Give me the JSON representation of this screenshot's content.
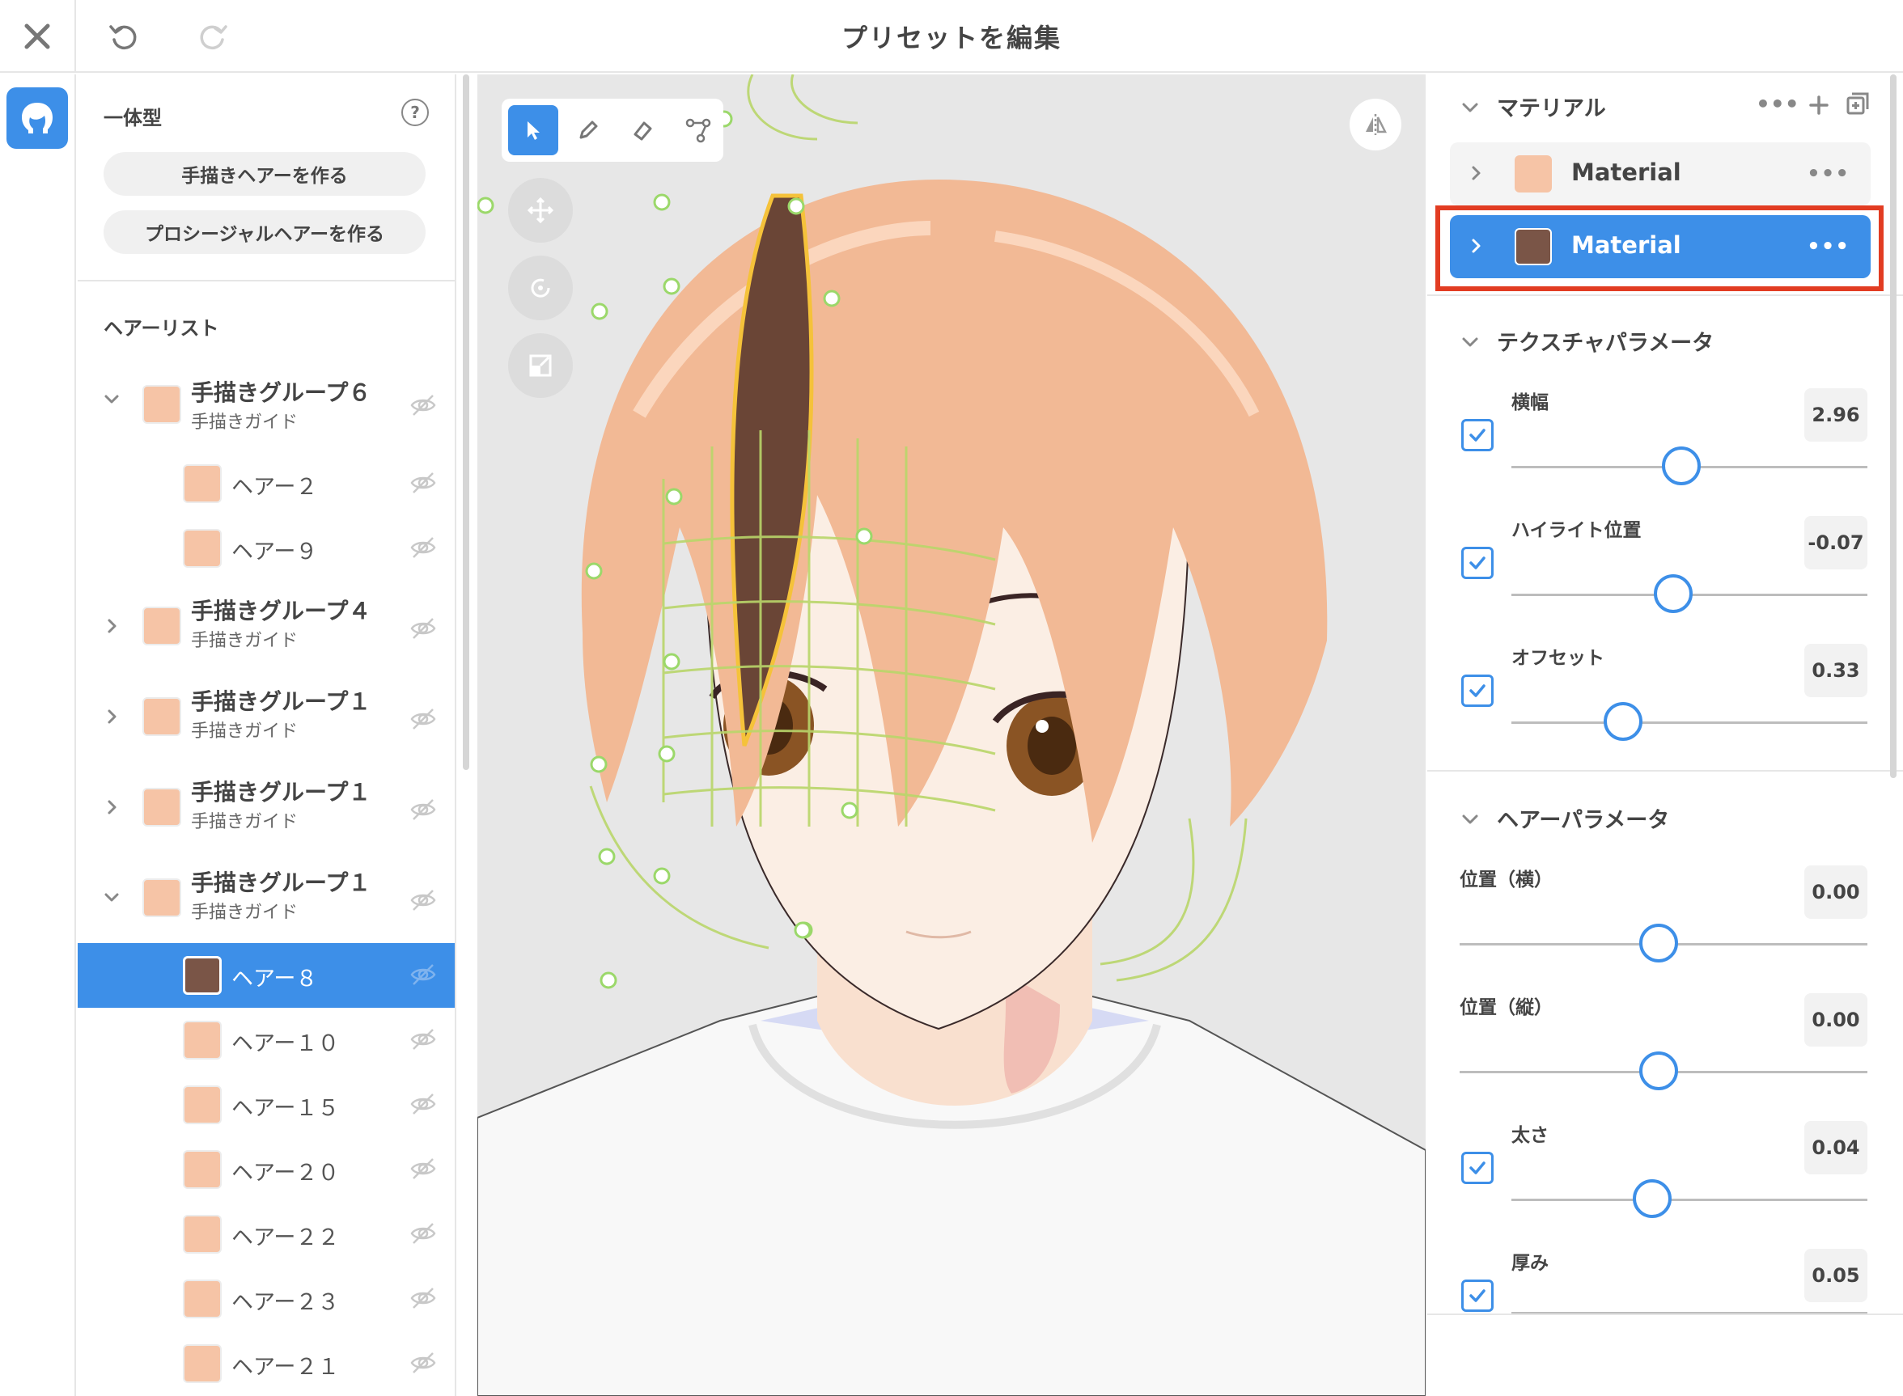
{
  "window": {
    "title": "プリセットを編集"
  },
  "colors": {
    "accent": "#3d8fe8",
    "hair_light": "#f6c4a6",
    "hair_dark": "#7a5547",
    "highlight_border": "#e23c22"
  },
  "left_panel": {
    "mode_label": "一体型",
    "buttons": {
      "hand_drawn": "手描きヘアーを作る",
      "procedural": "プロシージャルヘアーを作る"
    },
    "list_title": "ヘアーリスト",
    "items": [
      {
        "type": "group",
        "name": "手描きグループ６",
        "sub": "手描きガイド",
        "expanded": true
      },
      {
        "type": "hair",
        "name": "ヘアー２",
        "color": "light"
      },
      {
        "type": "hair",
        "name": "ヘアー９",
        "color": "light"
      },
      {
        "type": "group",
        "name": "手描きグループ４",
        "sub": "手描きガイド",
        "expanded": false
      },
      {
        "type": "group",
        "name": "手描きグループ１",
        "sub": "手描きガイド",
        "expanded": false
      },
      {
        "type": "group",
        "name": "手描きグループ１",
        "sub": "手描きガイド",
        "expanded": false
      },
      {
        "type": "group",
        "name": "手描きグループ１",
        "sub": "手描きガイド",
        "expanded": true
      },
      {
        "type": "hair",
        "name": "ヘアー８",
        "color": "dark",
        "selected": true
      },
      {
        "type": "hair",
        "name": "ヘアー１０",
        "color": "light"
      },
      {
        "type": "hair",
        "name": "ヘアー１５",
        "color": "light"
      },
      {
        "type": "hair",
        "name": "ヘアー２０",
        "color": "light"
      },
      {
        "type": "hair",
        "name": "ヘアー２２",
        "color": "light"
      },
      {
        "type": "hair",
        "name": "ヘアー２３",
        "color": "light"
      },
      {
        "type": "hair",
        "name": "ヘアー２１",
        "color": "light"
      }
    ]
  },
  "right_panel": {
    "material_section": {
      "title": "マテリアル",
      "materials": [
        {
          "label": "Material",
          "color": "#f6c4a6",
          "active": false
        },
        {
          "label": "Material",
          "color": "#7a5547",
          "active": true
        }
      ]
    },
    "texture_section": {
      "title": "テクスチャパラメータ",
      "params": [
        {
          "label": "横幅",
          "value": "2.96",
          "checked": true,
          "slider": 0.5
        },
        {
          "label": "ハイライト位置",
          "value": "-0.07",
          "checked": true,
          "slider": 0.47
        },
        {
          "label": "オフセット",
          "value": "0.33",
          "checked": true,
          "slider": 0.35
        }
      ]
    },
    "hair_section": {
      "title": "ヘアーパラメータ",
      "params": [
        {
          "label": "位置（横）",
          "value": "0.00",
          "checked": false,
          "slider": 0.5
        },
        {
          "label": "位置（縦）",
          "value": "0.00",
          "checked": false,
          "slider": 0.5
        },
        {
          "label": "太さ",
          "value": "0.04",
          "checked": true,
          "slider": 0.4
        },
        {
          "label": "厚み",
          "value": "0.05",
          "checked": true,
          "slider": 0.4
        }
      ]
    }
  }
}
